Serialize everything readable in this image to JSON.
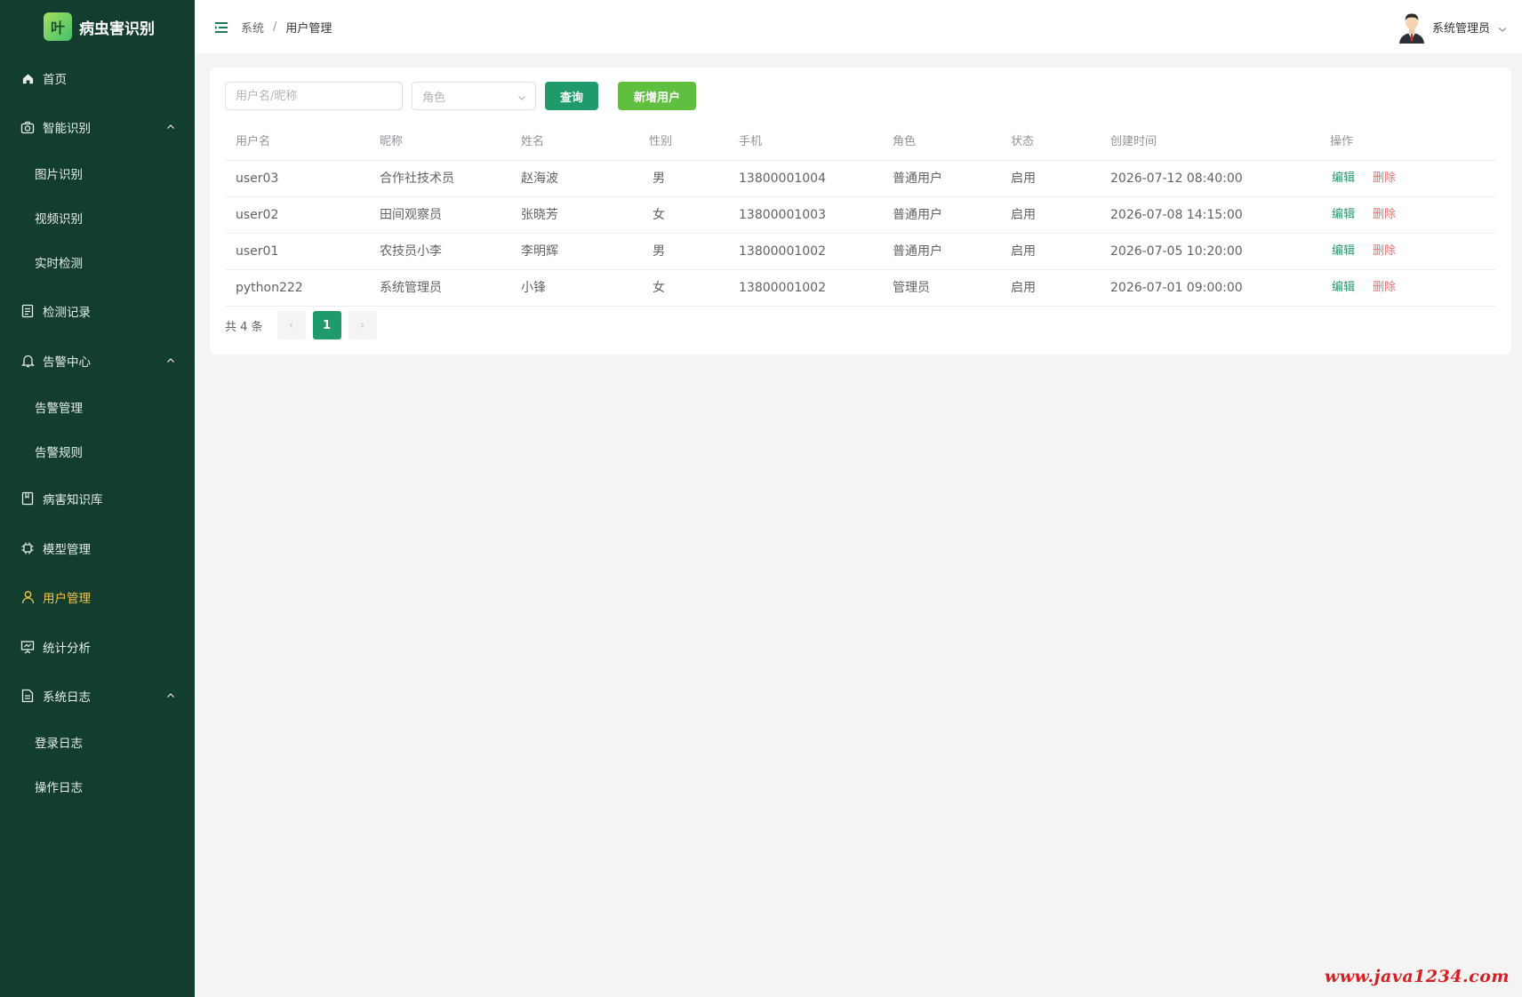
{
  "app": {
    "logo_char": "叶",
    "title": "病虫害识别"
  },
  "sidebar": {
    "items": [
      {
        "label": "首页",
        "icon": "home-icon"
      },
      {
        "label": "智能识别",
        "icon": "camera-icon",
        "expanded": true
      },
      {
        "label": "图片识别"
      },
      {
        "label": "视频识别"
      },
      {
        "label": "实时检测"
      },
      {
        "label": "检测记录",
        "icon": "list-icon"
      },
      {
        "label": "告警中心",
        "icon": "bell-icon",
        "expanded": true
      },
      {
        "label": "告警管理"
      },
      {
        "label": "告警规则"
      },
      {
        "label": "病害知识库",
        "icon": "book-icon"
      },
      {
        "label": "模型管理",
        "icon": "chip-icon"
      },
      {
        "label": "用户管理",
        "icon": "user-icon",
        "active": true
      },
      {
        "label": "统计分析",
        "icon": "presentation-icon"
      },
      {
        "label": "系统日志",
        "icon": "document-icon",
        "expanded": true
      },
      {
        "label": "登录日志"
      },
      {
        "label": "操作日志"
      }
    ]
  },
  "header": {
    "breadcrumb": [
      "系统",
      "用户管理"
    ],
    "separator": "/",
    "user_name": "系统管理员"
  },
  "filters": {
    "search_placeholder": "用户名/昵称",
    "role_placeholder": "角色",
    "query_label": "查询",
    "add_label": "新增用户"
  },
  "table": {
    "columns": [
      "用户名",
      "昵称",
      "姓名",
      "性别",
      "手机",
      "角色",
      "状态",
      "创建时间",
      "操作"
    ],
    "rows": [
      [
        "user03",
        "合作社技术员",
        "赵海波",
        "男",
        "13800001004",
        "普通用户",
        "启用",
        "2026-07-12 08:40:00"
      ],
      [
        "user02",
        "田间观察员",
        "张晓芳",
        "女",
        "13800001003",
        "普通用户",
        "启用",
        "2026-07-08 14:15:00"
      ],
      [
        "user01",
        "农技员小李",
        "李明辉",
        "男",
        "13800001002",
        "普通用户",
        "启用",
        "2026-07-05 10:20:00"
      ],
      [
        "python222",
        "系统管理员",
        "小锋",
        "女",
        "13800001002",
        "管理员",
        "启用",
        "2026-07-01 09:00:00"
      ]
    ],
    "edit_label": "编辑",
    "delete_label": "删除"
  },
  "pagination": {
    "total_text": "共 4 条",
    "current_page": "1",
    "prev": "‹",
    "next": "›"
  },
  "colors": {
    "sidebar_bg": "#133d2f",
    "primary": "#1f9a6a",
    "add_button": "#5fbf3e",
    "active_menu": "#f4c544",
    "danger": "#f56c6c"
  },
  "watermark": "www.java1234.com"
}
